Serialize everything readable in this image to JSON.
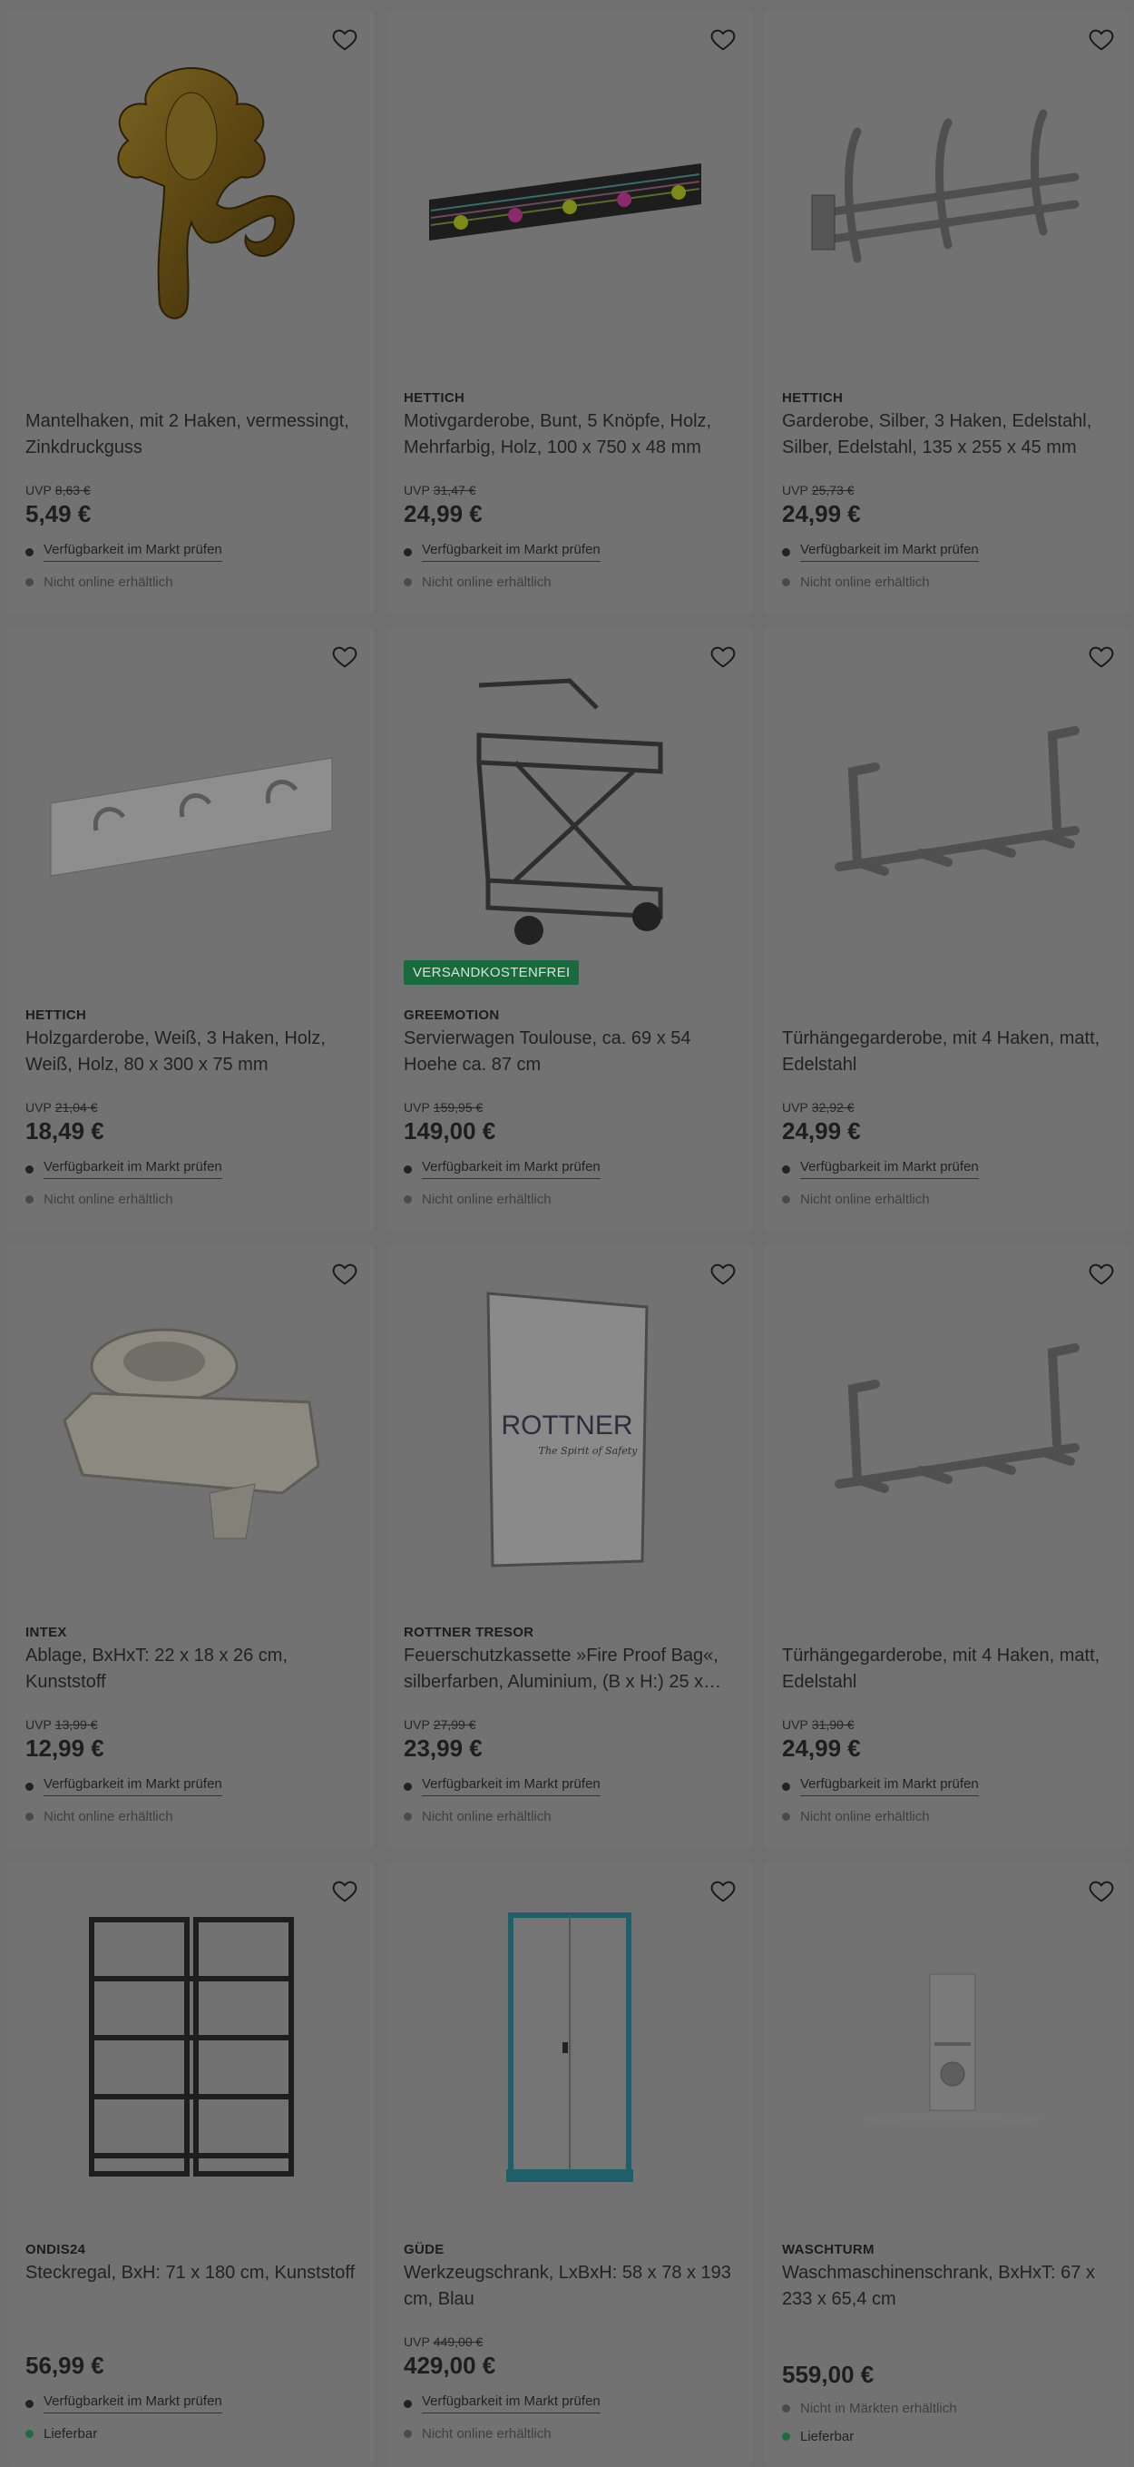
{
  "products": [
    {
      "brand": "",
      "title": "Mantelhaken, mit 2 Haken, vermessingt, Zinkdruckguss",
      "uvp_label": "UVP",
      "uvp": "8,63 €",
      "price": "5,49 €",
      "availability": "Verfügbarkeit im Markt prüfen",
      "status": "Nicht online erhältlich",
      "badge": ""
    },
    {
      "brand": "HETTICH",
      "title": "Motivgarderobe, Bunt, 5 Knöpfe, Holz, Mehrfarbig, Holz, 100 x 750 x 48 mm",
      "uvp_label": "UVP",
      "uvp": "31,47 €",
      "price": "24,99 €",
      "availability": "Verfügbarkeit im Markt prüfen",
      "status": "Nicht online erhältlich",
      "badge": ""
    },
    {
      "brand": "HETTICH",
      "title": "Garderobe, Silber, 3 Haken, Edelstahl, Silber, Edelstahl, 135 x 255 x 45 mm",
      "uvp_label": "UVP",
      "uvp": "25,73 €",
      "price": "24,99 €",
      "availability": "Verfügbarkeit im Markt prüfen",
      "status": "Nicht online erhältlich",
      "badge": ""
    },
    {
      "brand": "HETTICH",
      "title": "Holzgarderobe, Weiß, 3 Haken, Holz, Weiß, Holz, 80 x 300 x 75 mm",
      "uvp_label": "UVP",
      "uvp": "21,04 €",
      "price": "18,49 €",
      "availability": "Verfügbarkeit im Markt prüfen",
      "status": "Nicht online erhältlich",
      "badge": ""
    },
    {
      "brand": "GREEMOTION",
      "title": "Servierwagen Toulouse, ca. 69 x 54 Hoehe ca. 87 cm",
      "uvp_label": "UVP",
      "uvp": "159,95 €",
      "price": "149,00 €",
      "availability": "Verfügbarkeit im Markt prüfen",
      "status": "Nicht online erhältlich",
      "badge": "VERSANDKOSTENFREI"
    },
    {
      "brand": "",
      "title": "Türhängegarderobe, mit 4 Haken, matt, Edelstahl",
      "uvp_label": "UVP",
      "uvp": "32,92 €",
      "price": "24,99 €",
      "availability": "Verfügbarkeit im Markt prüfen",
      "status": "Nicht online erhältlich",
      "badge": ""
    },
    {
      "brand": "INTEX",
      "title": "Ablage, BxHxT: 22 x 18 x 26 cm, Kunststoff",
      "uvp_label": "UVP",
      "uvp": "13,99 €",
      "price": "12,99 €",
      "availability": "Verfügbarkeit im Markt prüfen",
      "status": "Nicht online erhältlich",
      "badge": ""
    },
    {
      "brand": "ROTTNER TRESOR",
      "title": "Feuerschutzkassette »Fire Proof Bag«, silberfarben, Aluminium, (B x H:) 25 x…",
      "uvp_label": "UVP",
      "uvp": "27,99 €",
      "price": "23,99 €",
      "availability": "Verfügbarkeit im Markt prüfen",
      "status": "Nicht online erhältlich",
      "badge": ""
    },
    {
      "brand": "",
      "title": "Türhängegarderobe, mit 4 Haken, matt, Edelstahl",
      "uvp_label": "UVP",
      "uvp": "31,90 €",
      "price": "24,99 €",
      "availability": "Verfügbarkeit im Markt prüfen",
      "status": "Nicht online erhältlich",
      "badge": ""
    },
    {
      "brand": "ONDIS24",
      "title": "Steckregal, BxH: 71 x 180 cm, Kunststoff",
      "uvp_label": "",
      "uvp": "",
      "price": "56,99 €",
      "availability": "Verfügbarkeit im Markt prüfen",
      "status": "Lieferbar",
      "badge": ""
    },
    {
      "brand": "GÜDE",
      "title": "Werkzeugschrank, LxBxH: 58 x 78 x 193 cm, Blau",
      "uvp_label": "UVP",
      "uvp": "449,00 €",
      "price": "429,00 €",
      "availability": "Verfügbarkeit im Markt prüfen",
      "status": "Nicht online erhältlich",
      "badge": ""
    },
    {
      "brand": "WASCHTURM",
      "title": "Waschmaschinenschrank, BxHxT: 67 x 233 x 65,4 cm",
      "uvp_label": "",
      "uvp": "",
      "price": "559,00 €",
      "availability": "Nicht in Märkten erhältlich",
      "status": "Lieferbar",
      "badge": ""
    }
  ],
  "ui": {
    "favorite_icon": "heart-outline-icon",
    "colors": {
      "overlay": "#6f6f6f",
      "badge_green": "#1b6a3f",
      "in_stock_dot": "#1f6b43"
    },
    "rottner_logo": "ROTTNER",
    "rottner_tagline": "The Spirit of Safety"
  }
}
